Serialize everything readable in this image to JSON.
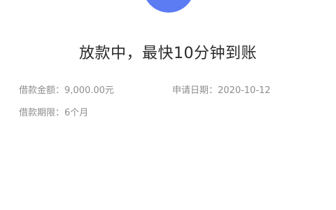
{
  "theme": {
    "accent": "#5b7cf2"
  },
  "status": {
    "icon": "status-circle-icon",
    "title": "放款中，最快10分钟到账"
  },
  "details": {
    "amount_label": "借款金额：",
    "amount_value": "9,000.00元",
    "date_label": "申请日期：",
    "date_value": "2020-10-12",
    "term_label": "借款期限：",
    "term_value": "6个月"
  }
}
